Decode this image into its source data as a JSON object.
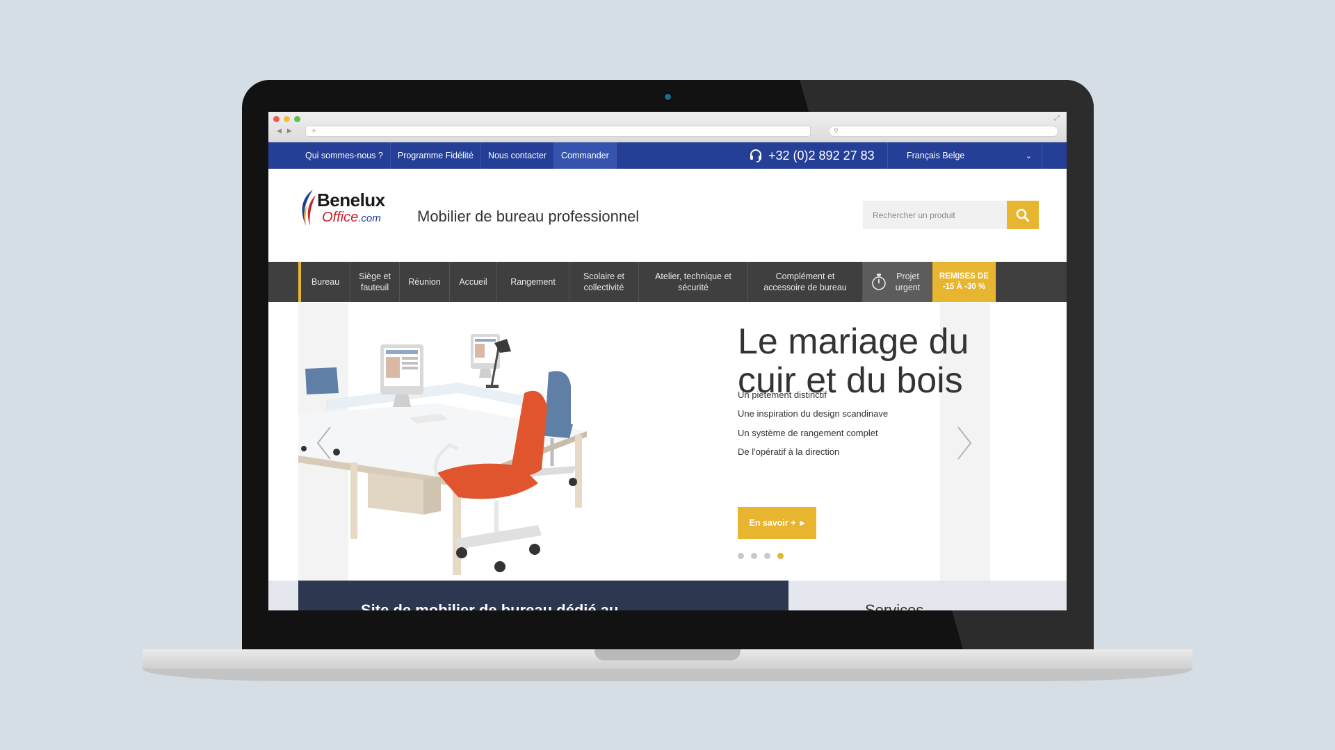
{
  "topbar": {
    "links": [
      {
        "label": "Qui sommes-nous ?"
      },
      {
        "label": "Programme Fidélité"
      },
      {
        "label": "Nous contacter"
      },
      {
        "label": "Commander"
      }
    ],
    "phone": "+32 (0)2 892 27 83",
    "language": "Français Belge"
  },
  "header": {
    "logo_name": "Benelux",
    "logo_sub": "Office",
    "logo_suffix": ".com",
    "tagline": "Mobilier de bureau professionnel",
    "search_placeholder": "Rechercher un produit"
  },
  "nav": {
    "items": [
      {
        "label": "Bureau"
      },
      {
        "label": "Siège et fauteuil"
      },
      {
        "label": "Réunion"
      },
      {
        "label": "Accueil"
      },
      {
        "label": "Rangement"
      },
      {
        "label": "Scolaire et collectivité"
      },
      {
        "label": "Atelier, technique et sécurité"
      },
      {
        "label": "Complément et accessoire de bureau"
      }
    ],
    "urgent_label": "Projet urgent",
    "promo_label": "REMISES DE -15 À -30 %"
  },
  "hero": {
    "title_line1": "Le mariage du",
    "title_line2": "cuir et du bois",
    "features": [
      "Un piètement distinctif",
      "Une inspiration du design scandinave",
      "Un système de rangement complet",
      "De l'opératif à la direction"
    ],
    "cta_label": "En savoir +",
    "slide_count": 4,
    "active_slide": 4
  },
  "bottom": {
    "left_title": "Site de mobilier de bureau dédié au",
    "right_title": "Services"
  },
  "colors": {
    "topbar": "#253f96",
    "accent": "#e8b530",
    "nav": "#3f3f3f"
  }
}
